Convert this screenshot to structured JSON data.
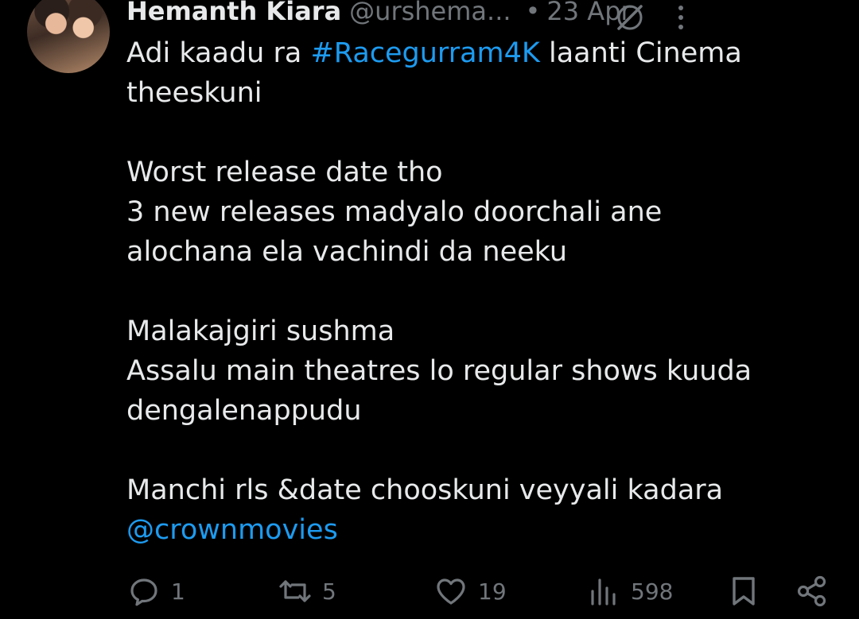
{
  "tweet": {
    "author_name": "Hemanth Kiara",
    "handle": "@urshema...",
    "separator": "•",
    "time": "23 Apr",
    "lines": [
      {
        "parts": [
          {
            "t": "Adi kaadu ra ",
            "link": false
          },
          {
            "t": "#Racegurram4K",
            "link": true
          },
          {
            "t": " laanti Cinema",
            "link": false
          }
        ]
      },
      {
        "parts": [
          {
            "t": "theeskuni",
            "link": false
          }
        ]
      },
      {
        "parts": []
      },
      {
        "parts": [
          {
            "t": "Worst release date tho",
            "link": false
          }
        ]
      },
      {
        "parts": [
          {
            "t": "3 new releases madyalo doorchali ane",
            "link": false
          }
        ]
      },
      {
        "parts": [
          {
            "t": "alochana ela vachindi da neeku",
            "link": false
          }
        ]
      },
      {
        "parts": []
      },
      {
        "parts": [
          {
            "t": "Malakajgiri sushma",
            "link": false
          }
        ]
      },
      {
        "parts": [
          {
            "t": "Assalu main theatres lo regular shows kuuda",
            "link": false
          }
        ]
      },
      {
        "parts": [
          {
            "t": "dengalenappudu",
            "link": false
          }
        ]
      },
      {
        "parts": []
      },
      {
        "parts": [
          {
            "t": "Manchi rls &date chooskuni veyyali kadara",
            "link": false
          }
        ]
      },
      {
        "parts": [
          {
            "t": "@crownmovies",
            "link": true
          }
        ]
      }
    ],
    "replies": "1",
    "reposts": "5",
    "likes": "19",
    "views": "598"
  },
  "colors": {
    "background": "#000000",
    "text": "#e7e9ea",
    "muted": "#71767b",
    "link": "#1d9bf0"
  },
  "icons": {
    "reply": "reply-icon",
    "repost": "repost-icon",
    "like": "heart-icon",
    "views": "views-icon",
    "bookmark": "bookmark-icon",
    "share": "share-icon",
    "grok": "grok-icon",
    "more": "more-icon"
  }
}
